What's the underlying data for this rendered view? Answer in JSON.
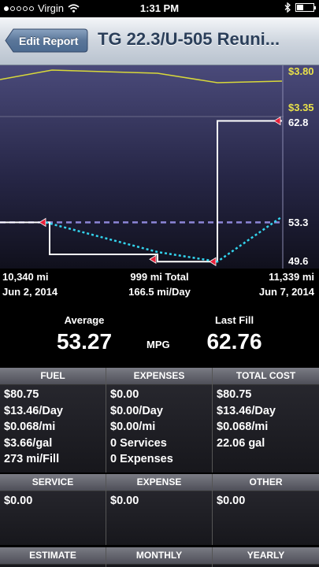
{
  "status": {
    "carrier": "Virgin",
    "time": "1:31 PM"
  },
  "nav": {
    "back_label": "Edit Report",
    "title": "TG 22.3/U-505 Reuni..."
  },
  "chart_data": {
    "type": "line",
    "price_axis_labels": [
      "$3.80",
      "$3.35"
    ],
    "mpg_axis_labels": [
      "62.8",
      "53.3",
      "49.6"
    ],
    "price_series": [
      3.68,
      3.8,
      3.76,
      3.74,
      3.64,
      3.66
    ],
    "mpg_series": [
      53.27,
      53.27,
      49.6,
      49.6,
      62.76,
      62.76
    ],
    "average_mpg": 53.27,
    "trend": [
      53.27,
      50.5,
      49.6,
      53.8
    ],
    "colors": {
      "price": "#d8d83a",
      "mpg": "#ffffff",
      "trend": "#33d4ee",
      "average": "#8d86d8",
      "marker": "#e8203a"
    }
  },
  "axis": {
    "start_mi": "10,340 mi",
    "start_date": "Jun 2, 2014",
    "total": "999 mi Total",
    "per_day": "166.5 mi/Day",
    "end_mi": "11,339 mi",
    "end_date": "Jun 7, 2014"
  },
  "summary": {
    "average_label": "Average",
    "average_value": "53.27",
    "unit": "MPG",
    "last_label": "Last Fill",
    "last_value": "62.76"
  },
  "panels": {
    "fuel": {
      "title": "FUEL",
      "lines": [
        "$80.75",
        "$13.46/Day",
        "$0.068/mi",
        "$3.66/gal",
        "273 mi/Fill"
      ]
    },
    "expenses": {
      "title": "EXPENSES",
      "lines": [
        "$0.00",
        "$0.00/Day",
        "$0.00/mi",
        "0 Services",
        "0 Expenses"
      ]
    },
    "total_cost": {
      "title": "TOTAL COST",
      "lines": [
        "$80.75",
        "$13.46/Day",
        "$0.068/mi",
        "22.06 gal"
      ]
    },
    "service": {
      "title": "SERVICE",
      "lines": [
        "$0.00"
      ]
    },
    "expense": {
      "title": "EXPENSE",
      "lines": [
        "$0.00"
      ]
    },
    "other": {
      "title": "OTHER",
      "lines": [
        "$0.00"
      ]
    },
    "estimate": {
      "title": "ESTIMATE"
    },
    "monthly": {
      "title": "MONTHLY"
    },
    "yearly": {
      "title": "YEARLY"
    }
  }
}
